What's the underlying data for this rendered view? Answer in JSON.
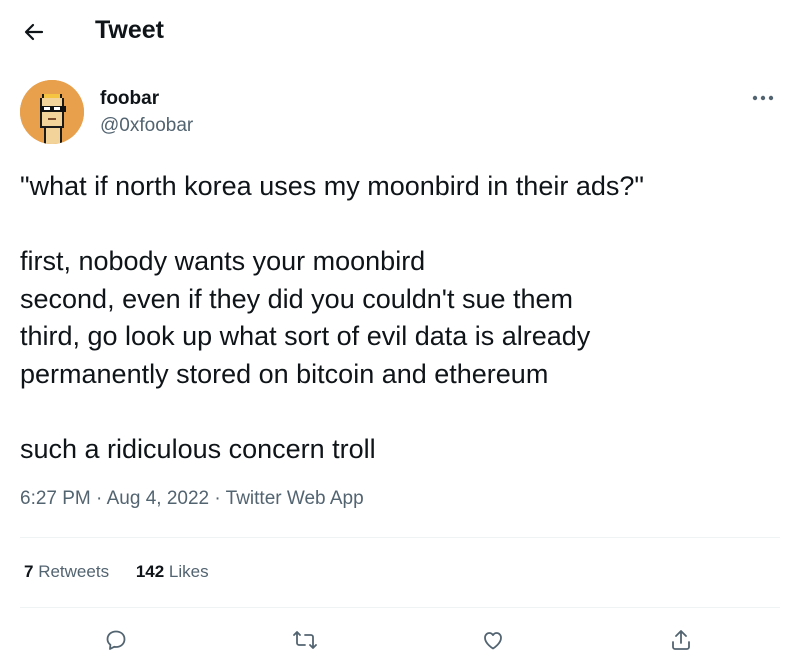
{
  "header": {
    "title": "Tweet",
    "back_icon": "arrow-left-icon"
  },
  "author": {
    "name": "foobar",
    "handle": "@0xfoobar",
    "avatar_bg": "#e8a04c"
  },
  "tweet": {
    "paragraphs": [
      [
        "\"what if north korea uses my moonbird in their ads?\""
      ],
      [
        "first, nobody wants your moonbird",
        "second, even if they did you couldn't sue them",
        "third, go look up what sort of evil data is already",
        "permanently stored on bitcoin and ethereum"
      ],
      [
        "such a ridiculous concern troll"
      ]
    ]
  },
  "meta": {
    "time": "6:27 PM",
    "date": "Aug 4, 2022",
    "source": "Twitter Web App",
    "separator": "·"
  },
  "stats": {
    "retweets_count": "7",
    "retweets_label": "Retweets",
    "likes_count": "142",
    "likes_label": "Likes"
  },
  "actions": [
    {
      "name": "reply-icon"
    },
    {
      "name": "retweet-icon"
    },
    {
      "name": "like-icon"
    },
    {
      "name": "share-icon"
    }
  ],
  "colors": {
    "text": "#0f1419",
    "secondary": "#536471",
    "divider": "#eff3f4"
  }
}
